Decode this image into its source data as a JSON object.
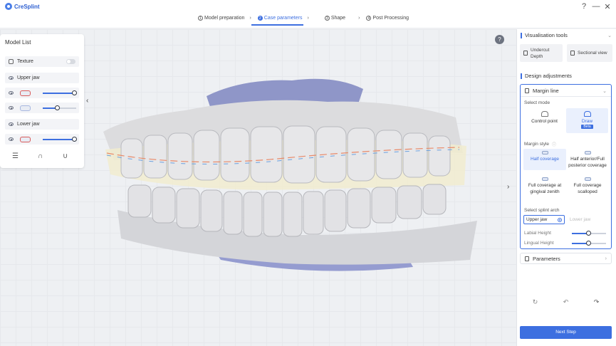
{
  "app": {
    "name": "CreSplint"
  },
  "window": {
    "help": "?",
    "minimize": "—",
    "close": "✕"
  },
  "steps": [
    {
      "num": "1",
      "label": "Model preparation",
      "sep": "›"
    },
    {
      "num": "2",
      "label": "Case parameters",
      "sep": "›"
    },
    {
      "num": "3",
      "label": "Shape",
      "sep": "›"
    },
    {
      "num": "4",
      "label": "Post Processing",
      "sep": ""
    }
  ],
  "model_list": {
    "title": "Model List",
    "texture_label": "Texture",
    "upper_jaw_label": "Upper jaw",
    "lower_jaw_label": "Lower jaw",
    "upper_slider_1": 1.0,
    "upper_slider_2": 0.55,
    "lower_slider_1": 1.0
  },
  "viewport": {
    "help_label": "?",
    "collapse_left": "‹",
    "collapse_right": "›"
  },
  "visualisation": {
    "title": "Visualisation tools",
    "undercut_depth": "Undercut Depth",
    "sectional_view": "Sectional view"
  },
  "design": {
    "title": "Design adjustments",
    "margin_line": {
      "title": "Margin line",
      "select_mode_label": "Select mode",
      "control_point": "Control point",
      "draw": "Draw",
      "beta": "Beta",
      "margin_style_label": "Margin style",
      "half_coverage": "Half coverage",
      "half_anterior": "Half anterior/Full posterior coverage",
      "full_gingival": "Full coverage at gingival zenith",
      "full_scalloped": "Full coverage scalloped",
      "splint_arch_label": "Select splint arch",
      "upper_jaw": "Upper jaw",
      "lower_jaw": "Lower jaw",
      "labial_height_label": "Labial Height",
      "lingual_height_label": "Lingual Height",
      "labial_height": 0.5,
      "lingual_height": 0.5
    },
    "parameters_label": "Parameters"
  },
  "toolbar": {
    "reset": "↻",
    "undo": "↶",
    "redo": "↷"
  },
  "next_step": "Next Step",
  "colors": {
    "accent": "#3d6fe0",
    "model_gray": "#d9dadc",
    "splint_tint": "#f1eccf",
    "base_purple": "#8f96c8"
  }
}
